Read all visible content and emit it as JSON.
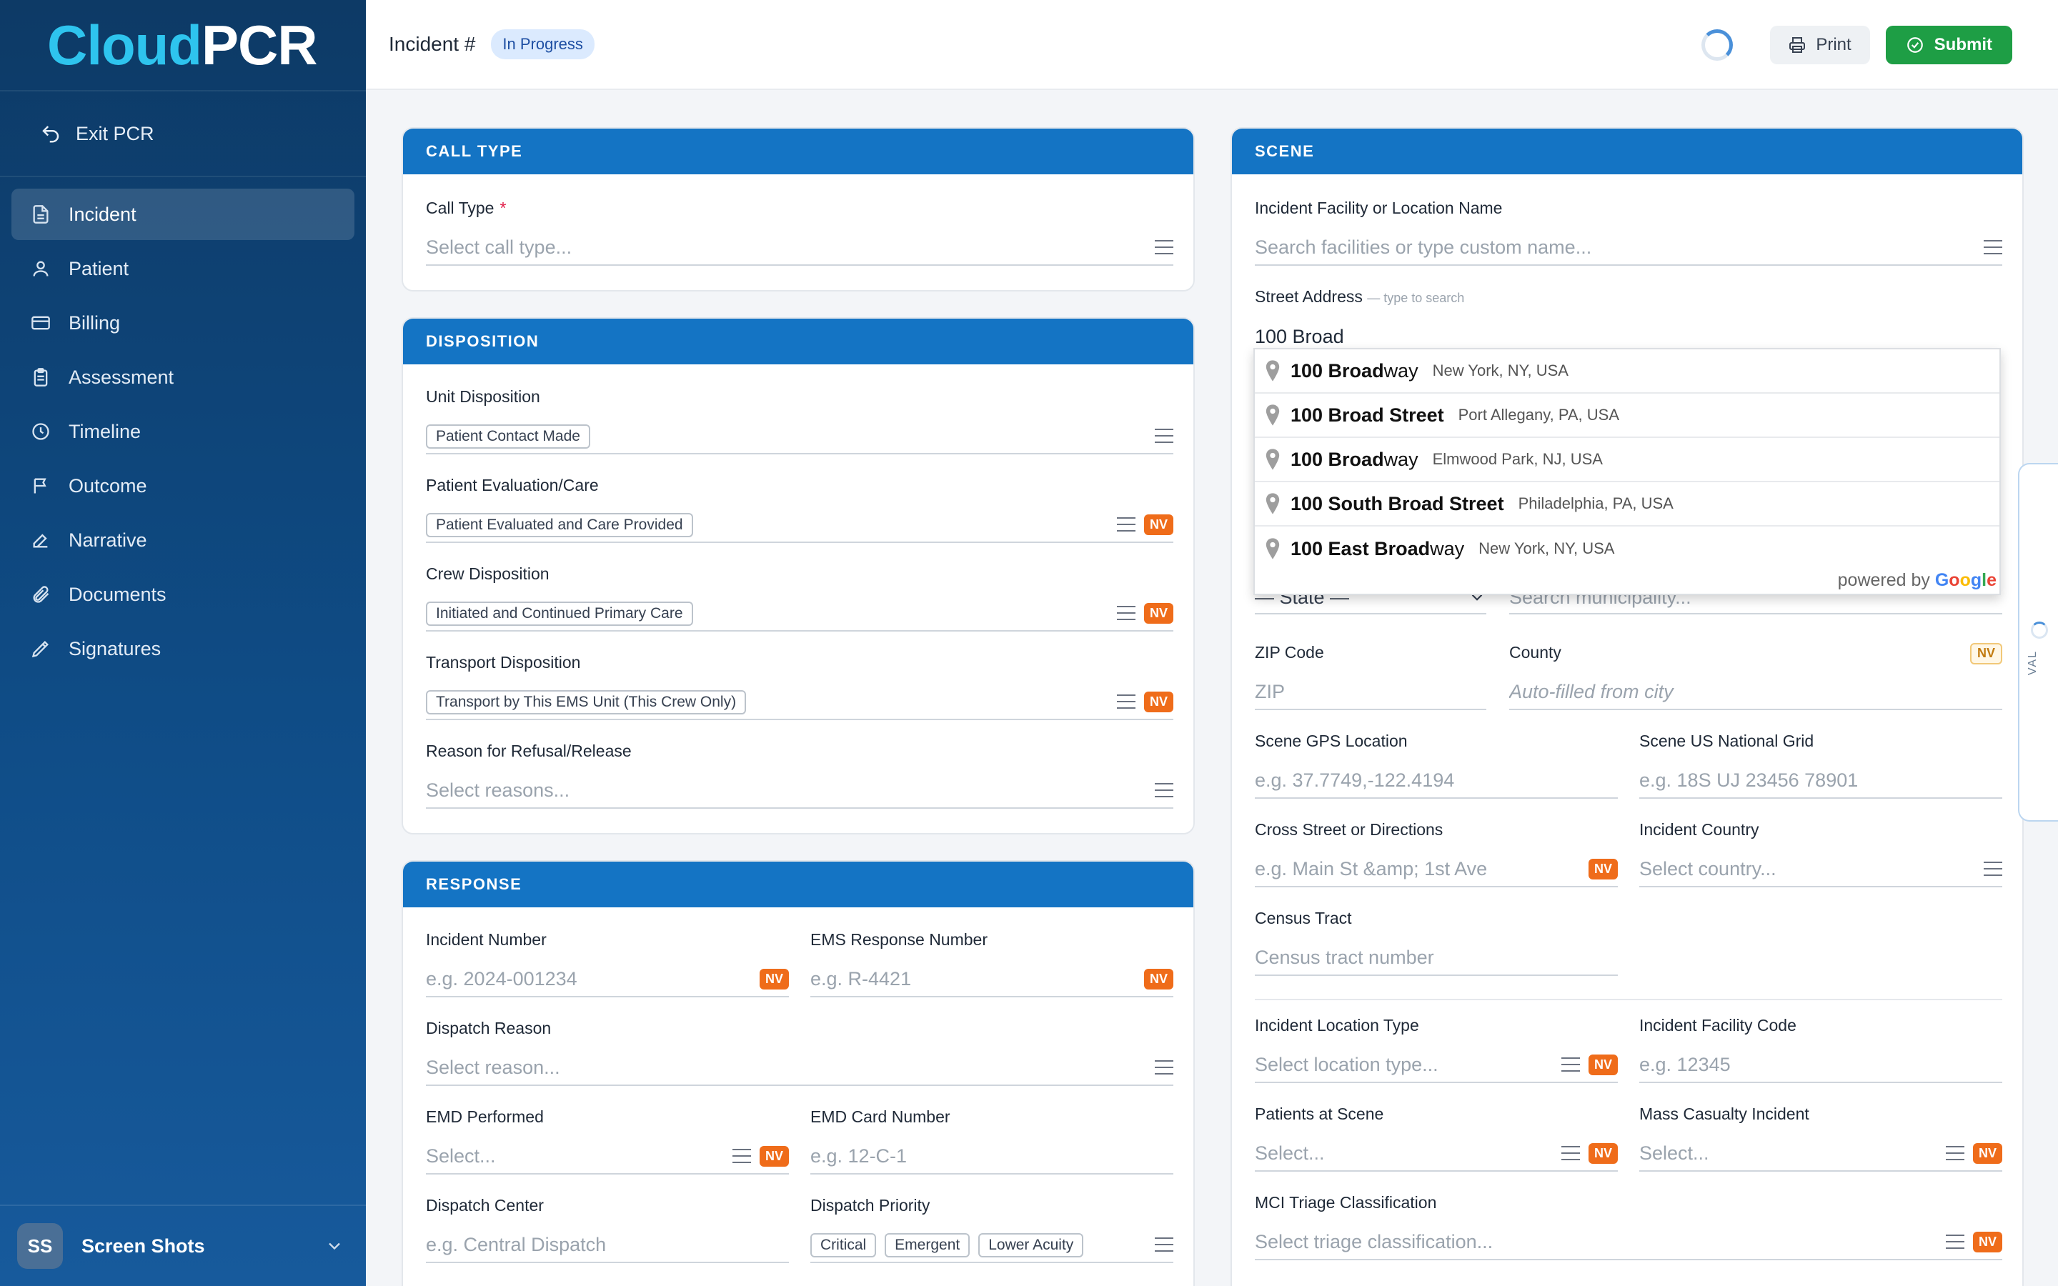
{
  "app": {
    "logo_part1": "Cloud",
    "logo_part2": "PCR"
  },
  "sidebar": {
    "exit_label": "Exit PCR",
    "items": [
      {
        "label": "Incident",
        "icon": "document-icon"
      },
      {
        "label": "Patient",
        "icon": "user-icon"
      },
      {
        "label": "Billing",
        "icon": "card-icon"
      },
      {
        "label": "Assessment",
        "icon": "clipboard-icon"
      },
      {
        "label": "Timeline",
        "icon": "clock-icon"
      },
      {
        "label": "Outcome",
        "icon": "flag-icon"
      },
      {
        "label": "Narrative",
        "icon": "edit-icon"
      },
      {
        "label": "Documents",
        "icon": "paperclip-icon"
      },
      {
        "label": "Signatures",
        "icon": "pen-icon"
      }
    ],
    "user": {
      "initials": "SS",
      "name": "Screen Shots"
    }
  },
  "header": {
    "title": "Incident #",
    "status": "In Progress",
    "print_label": "Print",
    "submit_label": "Submit"
  },
  "call_type": {
    "title": "CALL TYPE",
    "call_type_label": "Call Type",
    "required_mark": "*",
    "call_type_placeholder": "Select call type..."
  },
  "disposition": {
    "title": "DISPOSITION",
    "unit_label": "Unit Disposition",
    "unit_value": "Patient Contact Made",
    "eval_label": "Patient Evaluation/Care",
    "eval_value": "Patient Evaluated and Care Provided",
    "crew_label": "Crew Disposition",
    "crew_value": "Initiated and Continued Primary Care",
    "transport_label": "Transport Disposition",
    "transport_value": "Transport by This EMS Unit (This Crew Only)",
    "refusal_label": "Reason for Refusal/Release",
    "refusal_placeholder": "Select reasons..."
  },
  "response": {
    "title": "RESPONSE",
    "incident_number_label": "Incident Number",
    "incident_number_placeholder": "e.g. 2024-001234",
    "ems_response_label": "EMS Response Number",
    "ems_response_placeholder": "e.g. R-4421",
    "dispatch_reason_label": "Dispatch Reason",
    "dispatch_reason_placeholder": "Select reason...",
    "emd_performed_label": "EMD Performed",
    "emd_performed_placeholder": "Select...",
    "emd_card_label": "EMD Card Number",
    "emd_card_placeholder": "e.g. 12-C-1",
    "dispatch_center_label": "Dispatch Center",
    "dispatch_center_placeholder": "e.g. Central Dispatch",
    "dispatch_priority_label": "Dispatch Priority",
    "priority_options": [
      "Critical",
      "Emergent",
      "Lower Acuity"
    ]
  },
  "scene": {
    "title": "SCENE",
    "facility_label": "Incident Facility or Location Name",
    "facility_placeholder": "Search facilities or type custom name...",
    "street_label": "Street Address",
    "street_hint": "— type to search",
    "street_value": "100 Broad",
    "state_placeholder": "— State —",
    "city_placeholder": "Search municipality...",
    "zip_label": "ZIP Code",
    "zip_placeholder": "ZIP",
    "county_label": "County",
    "county_placeholder": "Auto-filled from city",
    "gps_label": "Scene GPS Location",
    "gps_placeholder": "e.g. 37.7749,-122.4194",
    "usng_label": "Scene US National Grid",
    "usng_placeholder": "e.g. 18S UJ 23456 78901",
    "cross_label": "Cross Street or Directions",
    "cross_placeholder": "e.g. Main St &amp; 1st Ave",
    "country_label": "Incident Country",
    "country_placeholder": "Select country...",
    "census_label": "Census Tract",
    "census_placeholder": "Census tract number",
    "loc_type_label": "Incident Location Type",
    "loc_type_placeholder": "Select location type...",
    "facility_code_label": "Incident Facility Code",
    "facility_code_placeholder": "e.g. 12345",
    "patients_label": "Patients at Scene",
    "patients_placeholder": "Select...",
    "mci_label": "Mass Casualty Incident",
    "mci_placeholder": "Select...",
    "triage_label": "MCI Triage Classification",
    "triage_placeholder": "Select triage classification..."
  },
  "autocomplete": {
    "suggestions": [
      {
        "bold": "100 Broad",
        "rest": "way",
        "sub": "New York, NY, USA"
      },
      {
        "bold": "100 Broad",
        "rest": " Street",
        "sub": "Port Allegany, PA, USA"
      },
      {
        "bold": "100 Broad",
        "rest": "way",
        "sub": "Elmwood Park, NJ, USA"
      },
      {
        "bold": "100 South Broad Street",
        "rest": "",
        "sub": "Philadelphia, PA, USA"
      },
      {
        "bold": "100 East Broad",
        "rest": "way",
        "sub": "New York, NY, USA"
      }
    ],
    "powered_by": "powered by",
    "google": [
      "G",
      "o",
      "o",
      "g",
      "l",
      "e"
    ]
  },
  "nv_badge": "NV",
  "val_tab_label": "VAL",
  "colors": {
    "primary": "#1474c4",
    "submit": "#1e9e45",
    "nv": "#ef6c1a",
    "sidebar": "#0f4c86"
  }
}
